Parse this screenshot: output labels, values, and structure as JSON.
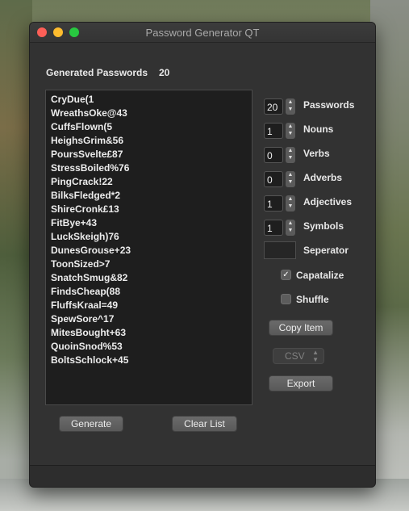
{
  "window": {
    "title": "Password Generator QT"
  },
  "header": {
    "label": "Generated Passwords",
    "count": "20"
  },
  "passwords": [
    "CryDue(1",
    "WreathsOke@43",
    "CuffsFlown(5",
    "HeighsGrim&56",
    "PoursSvelte£87",
    "StressBoiled%76",
    "PingCrack!22",
    "BilksFledged*2",
    "ShireCronk£13",
    "FitBye+43",
    "LuckSkeigh)76",
    "DunesGrouse+23",
    "ToonSized>7",
    "SnatchSmug&82",
    "FindsCheap(88",
    "FluffsKraal=49",
    "SpewSore^17",
    "MitesBought+63",
    "QuoinSnod%53",
    "BoltsSchlock+45"
  ],
  "options": [
    {
      "value": "20",
      "label": "Passwords"
    },
    {
      "value": "1",
      "label": "Nouns"
    },
    {
      "value": "0",
      "label": "Verbs"
    },
    {
      "value": "0",
      "label": "Adverbs"
    },
    {
      "value": "1",
      "label": "Adjectives"
    },
    {
      "value": "1",
      "label": "Symbols"
    }
  ],
  "separator": {
    "label": "Seperator",
    "value": ""
  },
  "checkboxes": {
    "capitalize": {
      "label": "Capatalize",
      "checked": true,
      "mark": "✓"
    },
    "shuffle": {
      "label": "Shuffle",
      "checked": false
    }
  },
  "buttons": {
    "copy_item": "Copy Item",
    "format": "CSV",
    "export": "Export",
    "generate": "Generate",
    "clear_list": "Clear List"
  }
}
